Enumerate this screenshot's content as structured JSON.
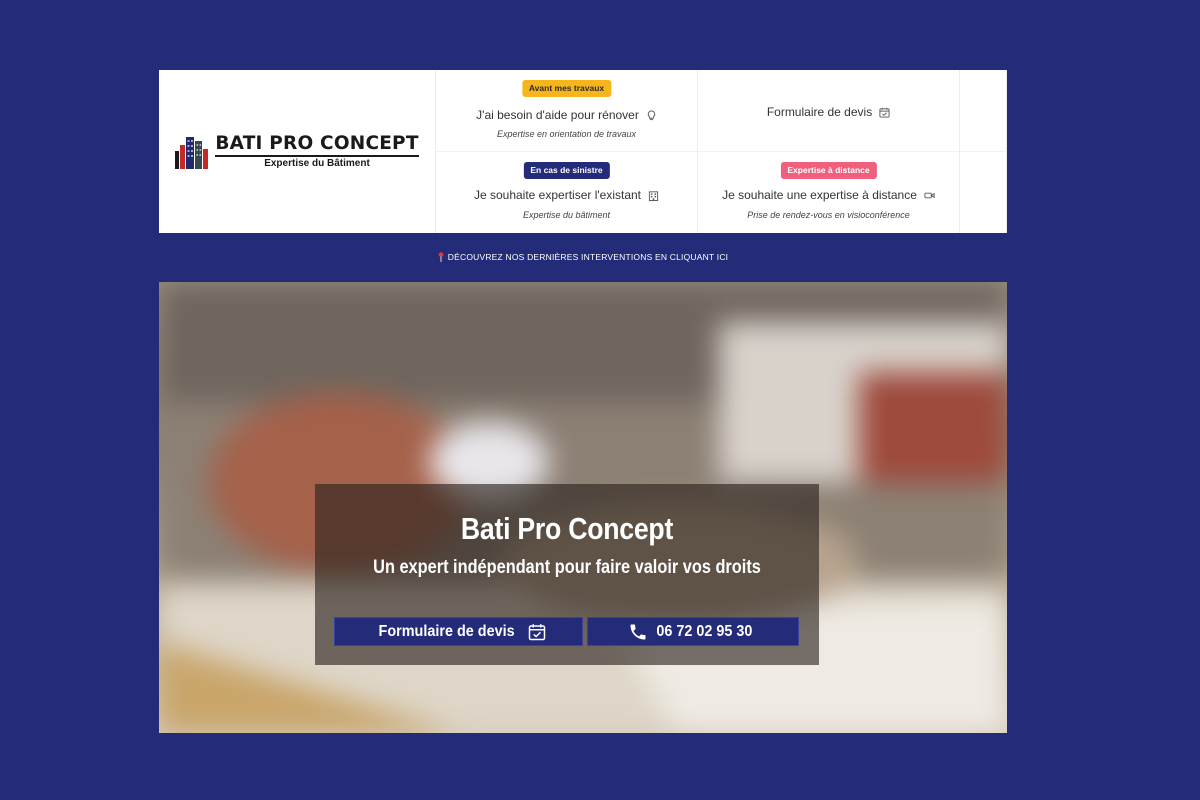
{
  "brand": {
    "name": "BATI PRO CONCEPT",
    "tagline": "Expertise du Bâtiment"
  },
  "menu": [
    {
      "badge": "Avant mes travaux",
      "badge_color": "#f7b51c",
      "title": "J'ai besoin d'aide pour rénover",
      "icon": "lightbulb-icon",
      "subtitle": "Expertise en orientation de travaux"
    },
    {
      "badge": "",
      "title": "Formulaire de devis",
      "icon": "calendar-check-icon",
      "subtitle": ""
    },
    {
      "badge": "En cas de sinistre",
      "badge_color": "#242b78",
      "title": "Je souhaite expertiser l'existant",
      "icon": "building-icon",
      "subtitle": "Expertise du bâtiment"
    },
    {
      "badge": "Expertise à distance",
      "badge_color": "#f0607d",
      "title": "Je souhaite une expertise à distance",
      "icon": "video-icon",
      "subtitle": "Prise de rendez-vous en visioconférence"
    }
  ],
  "ticker": {
    "icon": "pin-icon",
    "text": "DÉCOUVREZ NOS DERNIÈRES INTERVENTIONS EN CLIQUANT ICI"
  },
  "hero": {
    "title": "Bati Pro Concept",
    "subtitle": "Un expert indépendant pour faire valoir vos droits",
    "quote_button": "Formulaire de devis",
    "phone_button": "06 72 02 95 30"
  },
  "colors": {
    "background": "#242b78",
    "button": "#242b78",
    "badge_yellow": "#f7b51c",
    "badge_pink": "#f0607d"
  }
}
